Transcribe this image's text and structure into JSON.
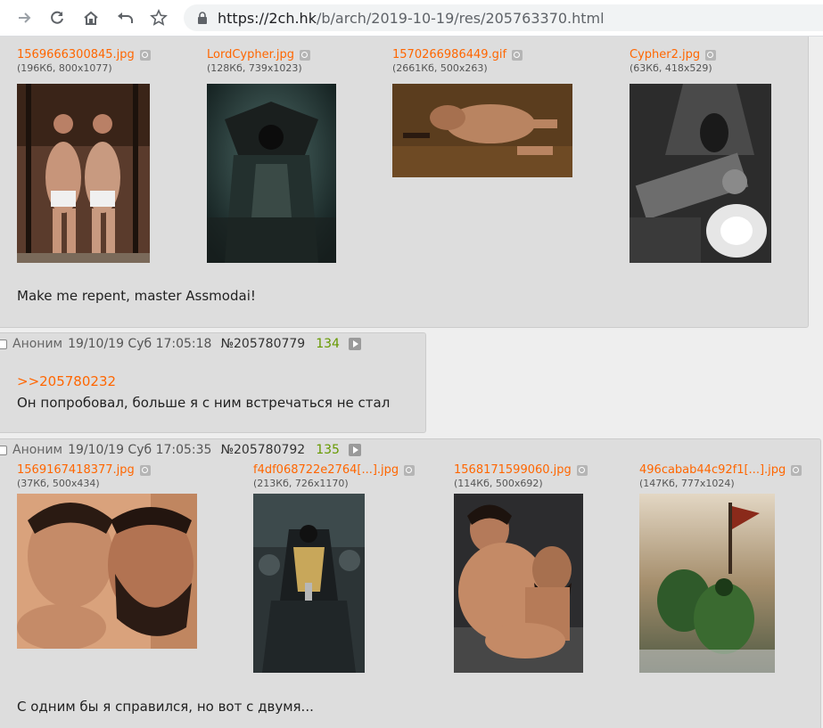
{
  "browser": {
    "url_host": "https://2ch.hk",
    "url_path": "/b/arch/2019-10-19/res/205763370.html"
  },
  "posts": [
    {
      "files": [
        {
          "name": "1569666300845.jpg",
          "meta": "(196Кб, 800x1077)"
        },
        {
          "name": "LordCypher.jpg",
          "meta": "(128Кб, 739x1023)"
        },
        {
          "name": "1570266986449.gif",
          "meta": "(2661Кб, 500x263)"
        },
        {
          "name": "Cypher2.jpg",
          "meta": "(63Кб, 418x529)"
        }
      ],
      "text": "Make me repent, master Assmodai!"
    },
    {
      "author": "Аноним",
      "date": "19/10/19 Суб 17:05:18",
      "number": "№205780779",
      "count": "134",
      "reply_link": ">>205780232",
      "text": "Он попробовал, больше я с ним встречаться не стал"
    },
    {
      "author": "Аноним",
      "date": "19/10/19 Суб 17:05:35",
      "number": "№205780792",
      "count": "135",
      "files": [
        {
          "name": "1569167418377.jpg",
          "meta": "(37Кб, 500x434)"
        },
        {
          "name": "f4df068722e2764[...].jpg",
          "meta": "(213Кб, 726x1170)"
        },
        {
          "name": "1568171599060.jpg",
          "meta": "(114Кб, 500x692)"
        },
        {
          "name": "496cabab44c92f1[...].jpg",
          "meta": "(147Кб, 777x1024)"
        }
      ],
      "text": "С одним бы я справился, но вот с двумя..."
    }
  ]
}
